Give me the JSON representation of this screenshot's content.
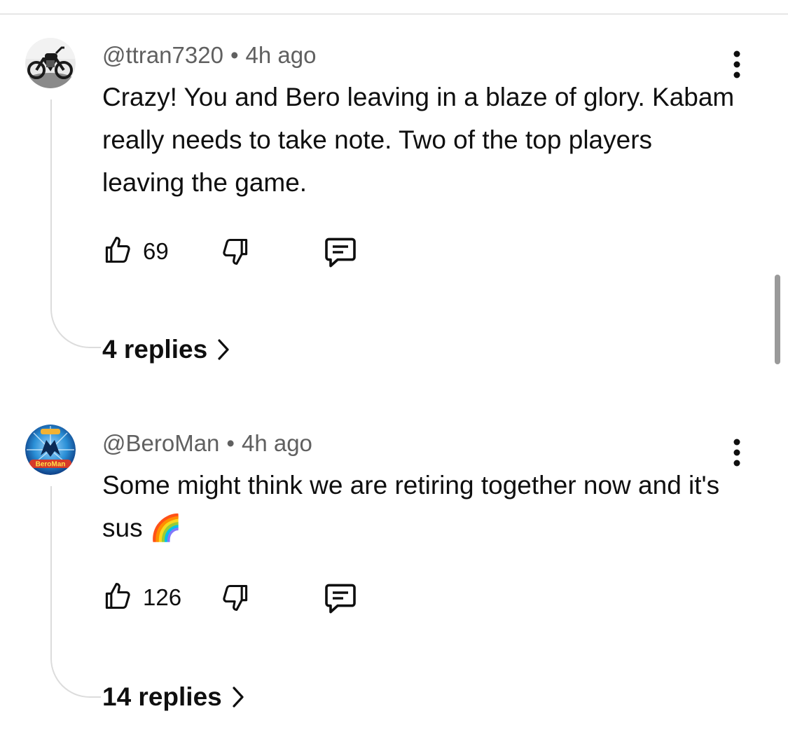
{
  "comments": [
    {
      "author": "@ttran7320",
      "separator": "•",
      "time": "4h ago",
      "text": "Crazy! You and Bero leaving in a blaze of glory. Kabam really needs to take note. Two of the top players leaving the game.",
      "likes": "69",
      "replies_label": "4 replies",
      "avatar_icon": "motorcycle-avatar"
    },
    {
      "author": "@BeroMan",
      "separator": "•",
      "time": "4h ago",
      "text": "Some might think we are retiring together now and it's sus ",
      "emoji": "🌈",
      "likes": "126",
      "replies_label": "14 replies",
      "avatar_icon": "beroman-logo-avatar",
      "avatar_logo_text": "BeroMan"
    }
  ],
  "icons": {
    "like": "thumbs-up-icon",
    "dislike": "thumbs-down-icon",
    "reply": "reply-comment-icon",
    "more": "more-vertical-icon",
    "chevron": "chevron-right-icon"
  },
  "colors": {
    "text": "#0f0f0f",
    "meta": "#606060",
    "thread_line": "#dcdcdc",
    "avatar_blue": "#2a8fd6"
  }
}
